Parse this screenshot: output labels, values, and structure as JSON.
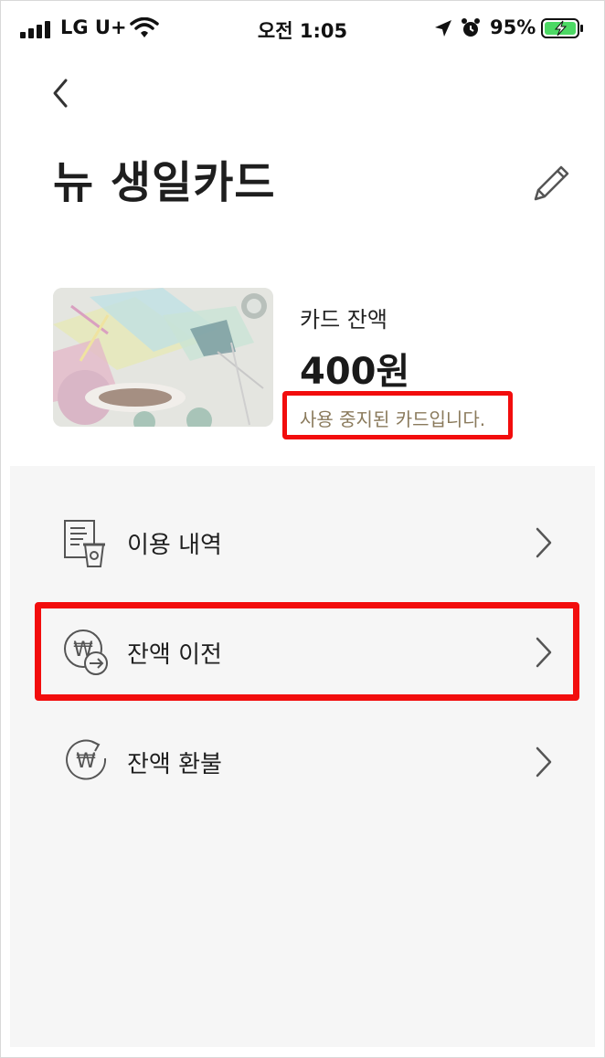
{
  "status_bar": {
    "carrier": "LG U+",
    "time": "오전 1:05",
    "battery": "95%",
    "icons": [
      "signal-icon",
      "wifi-icon",
      "location-icon",
      "alarm-icon",
      "battery-icon"
    ]
  },
  "header": {
    "title": "뉴 생일카드",
    "back_icon": "back-chevron-icon",
    "edit_icon": "pencil-icon"
  },
  "card": {
    "balance_label": "카드 잔액",
    "balance_value": "400원",
    "status_message": "사용 중지된 카드입니다."
  },
  "menu": {
    "items": [
      {
        "label": "이용 내역",
        "icon": "receipt-cup-icon"
      },
      {
        "label": "잔액 이전",
        "icon": "won-transfer-icon"
      },
      {
        "label": "잔액 환불",
        "icon": "won-refund-icon"
      }
    ]
  },
  "colors": {
    "highlight": "#f20d0d",
    "status_text": "#8a7a5c",
    "menu_background": "#f6f6f6"
  }
}
